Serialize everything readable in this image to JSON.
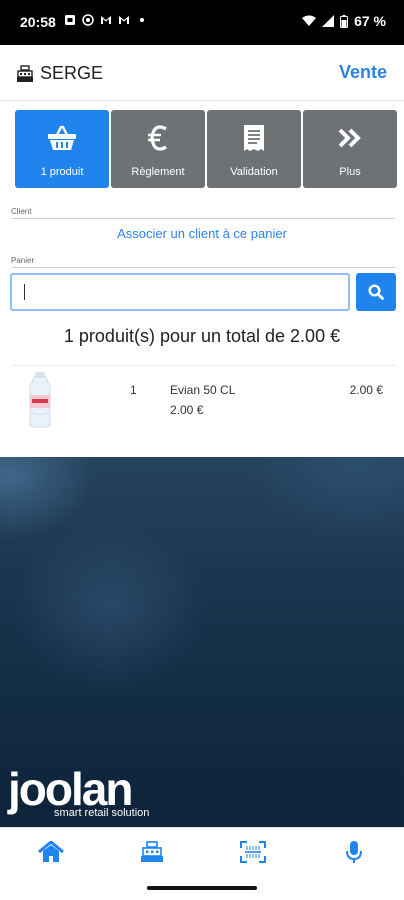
{
  "status_bar": {
    "time": "20:58",
    "battery": "67 %",
    "icons": [
      "sim-icon",
      "whatsapp-icon",
      "gmail-icon",
      "gmail-icon",
      "dot-icon",
      "wifi-icon",
      "signal-icon",
      "battery-icon"
    ]
  },
  "header": {
    "title": "SERGE",
    "title_icon": "cash-register-icon",
    "action": "Vente"
  },
  "tabs": [
    {
      "label": "1 produit",
      "icon": "basket-icon",
      "active": true
    },
    {
      "label": "Règlement",
      "icon": "euro-icon",
      "active": false
    },
    {
      "label": "Validation",
      "icon": "receipt-icon",
      "active": false
    },
    {
      "label": "Plus",
      "icon": "double-chevron-right-icon",
      "active": false
    }
  ],
  "client": {
    "section_label": "Client",
    "link": "Associer un client à ce panier"
  },
  "panier": {
    "section_label": "Panier",
    "search_value": "",
    "search_icon": "search-icon"
  },
  "summary": "1 produit(s) pour un total de 2.00 €",
  "cart": [
    {
      "qty": "1",
      "name": "Evian 50 CL",
      "unit_price": "2.00 €",
      "total": "2.00 €",
      "image": "water-bottle"
    }
  ],
  "brand": {
    "logo": "joolan",
    "tagline": "smart retail solution"
  },
  "bottom_nav": [
    {
      "icon": "home-icon",
      "active": true
    },
    {
      "icon": "cash-register-icon",
      "active": false
    },
    {
      "icon": "scan-icon",
      "active": false
    },
    {
      "icon": "microphone-icon",
      "active": false
    }
  ],
  "colors": {
    "accent": "#1f84ee",
    "link": "#2d82e8",
    "tab_inactive": "#6f7275",
    "background_dark": "#16324b"
  }
}
